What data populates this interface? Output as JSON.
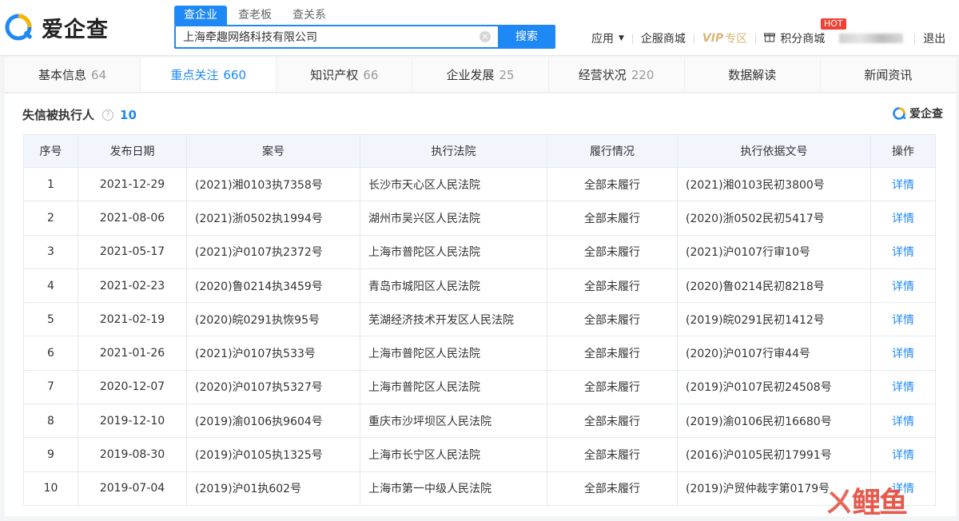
{
  "header": {
    "brand": "爱企查",
    "search_tabs": [
      "查企业",
      "查老板",
      "查关系"
    ],
    "search_value": "上海牵趣网络科技有限公司",
    "search_button": "搜索",
    "nav": {
      "app": "应用",
      "mall": "企服商城",
      "vip": "VIP",
      "vip_zone": "专区",
      "points_mall": "积分商城",
      "hot": "HOT",
      "logout": "退出"
    }
  },
  "tabs": [
    {
      "label": "基本信息",
      "count": "64"
    },
    {
      "label": "重点关注",
      "count": "660"
    },
    {
      "label": "知识产权",
      "count": "66"
    },
    {
      "label": "企业发展",
      "count": "25"
    },
    {
      "label": "经营状况",
      "count": "220"
    },
    {
      "label": "数据解读",
      "count": ""
    },
    {
      "label": "新闻资讯",
      "count": ""
    }
  ],
  "section": {
    "title": "失信被执行人",
    "count": "10",
    "brand": "爱企查"
  },
  "table": {
    "headers": [
      "序号",
      "发布日期",
      "案号",
      "执行法院",
      "履行情况",
      "执行依据文号",
      "操作"
    ],
    "rows": [
      [
        "1",
        "2021-12-29",
        "(2021)湘0103执7358号",
        "长沙市天心区人民法院",
        "全部未履行",
        "(2021)湘0103民初3800号",
        "详情"
      ],
      [
        "2",
        "2021-08-06",
        "(2021)浙0502执1994号",
        "湖州市吴兴区人民法院",
        "全部未履行",
        "(2020)浙0502民初5417号",
        "详情"
      ],
      [
        "3",
        "2021-05-17",
        "(2021)沪0107执2372号",
        "上海市普陀区人民法院",
        "全部未履行",
        "(2021)沪0107行审10号",
        "详情"
      ],
      [
        "4",
        "2021-02-23",
        "(2020)鲁0214执3459号",
        "青岛市城阳区人民法院",
        "全部未履行",
        "(2020)鲁0214民初8218号",
        "详情"
      ],
      [
        "5",
        "2021-02-19",
        "(2020)皖0291执恢95号",
        "芜湖经济技术开发区人民法院",
        "全部未履行",
        "(2019)皖0291民初1412号",
        "详情"
      ],
      [
        "6",
        "2021-01-26",
        "(2021)沪0107执533号",
        "上海市普陀区人民法院",
        "全部未履行",
        "(2020)沪0107行审44号",
        "详情"
      ],
      [
        "7",
        "2020-12-07",
        "(2020)沪0107执5327号",
        "上海市普陀区人民法院",
        "全部未履行",
        "(2019)沪0107民初24508号",
        "详情"
      ],
      [
        "8",
        "2019-12-10",
        "(2019)渝0106执9604号",
        "重庆市沙坪坝区人民法院",
        "全部未履行",
        "(2019)渝0106民初16680号",
        "详情"
      ],
      [
        "9",
        "2019-08-30",
        "(2019)沪0105执1325号",
        "上海市长宁区人民法院",
        "全部未履行",
        "(2016)沪0105民初17991号",
        "详情"
      ],
      [
        "10",
        "2019-07-04",
        "(2019)沪01执602号",
        "上海市第一中级人民法院",
        "全部未履行",
        "(2019)沪贸仲裁字第0179号",
        "详情"
      ]
    ]
  },
  "watermark": "鲤鱼",
  "colors": {
    "accent": "#1e88f5",
    "hot": "#f04134",
    "vip": "#d9b67a"
  }
}
